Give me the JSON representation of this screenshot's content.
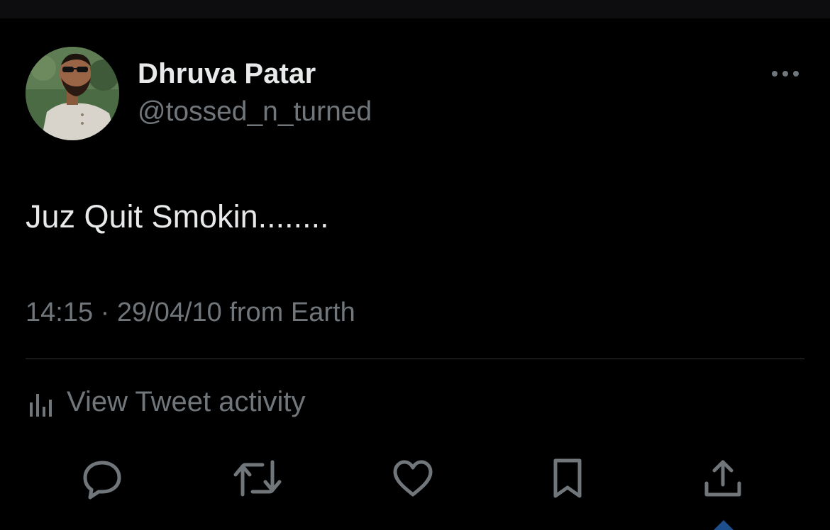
{
  "author": {
    "display_name": "Dhruva Patar",
    "handle": "@tossed_n_turned"
  },
  "tweet": {
    "text": "Juz Quit Smokin........",
    "timestamp": "14:15 · 29/04/10 from Earth"
  },
  "activity": {
    "label": "View Tweet activity",
    "icon": "bar-chart-icon"
  },
  "actions": [
    {
      "name": "reply",
      "icon": "speech-bubble-icon"
    },
    {
      "name": "retweet",
      "icon": "retweet-arrows-icon"
    },
    {
      "name": "like",
      "icon": "heart-icon"
    },
    {
      "name": "bookmark",
      "icon": "bookmark-icon"
    },
    {
      "name": "share",
      "icon": "share-upload-icon"
    }
  ],
  "colors": {
    "background": "#000000",
    "primary_text": "#e7e9ea",
    "secondary_text": "#71767b",
    "divider": "#2f3336"
  }
}
